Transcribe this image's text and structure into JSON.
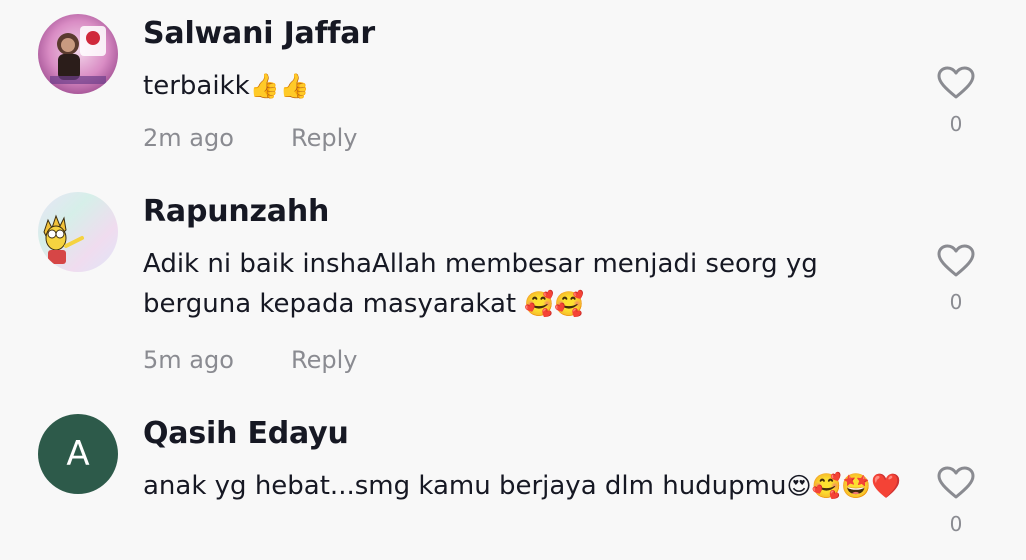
{
  "comments": [
    {
      "username": "Salwani Jaffar",
      "text": "terbaikk",
      "emoji": "👍👍",
      "time": "2m ago",
      "reply_label": "Reply",
      "likes": "0"
    },
    {
      "username": "Rapunzahh",
      "text": "Adik ni baik inshaAllah membesar menjadi seorg yg berguna kepada masyarakat ",
      "emoji": "🥰🥰",
      "time": "5m ago",
      "reply_label": "Reply",
      "likes": "0"
    },
    {
      "username": "Qasih Edayu",
      "avatar_letter": "A",
      "text": "anak yg hebat...smg kamu berjaya dlm hudupmu",
      "emoji": "😍🥰🤩❤️",
      "likes": "0"
    }
  ],
  "colors": {
    "background": "#f8f8f8",
    "text": "#161823",
    "secondary_text": "#8a8b91",
    "avatar_green": "#2d5a4a"
  }
}
